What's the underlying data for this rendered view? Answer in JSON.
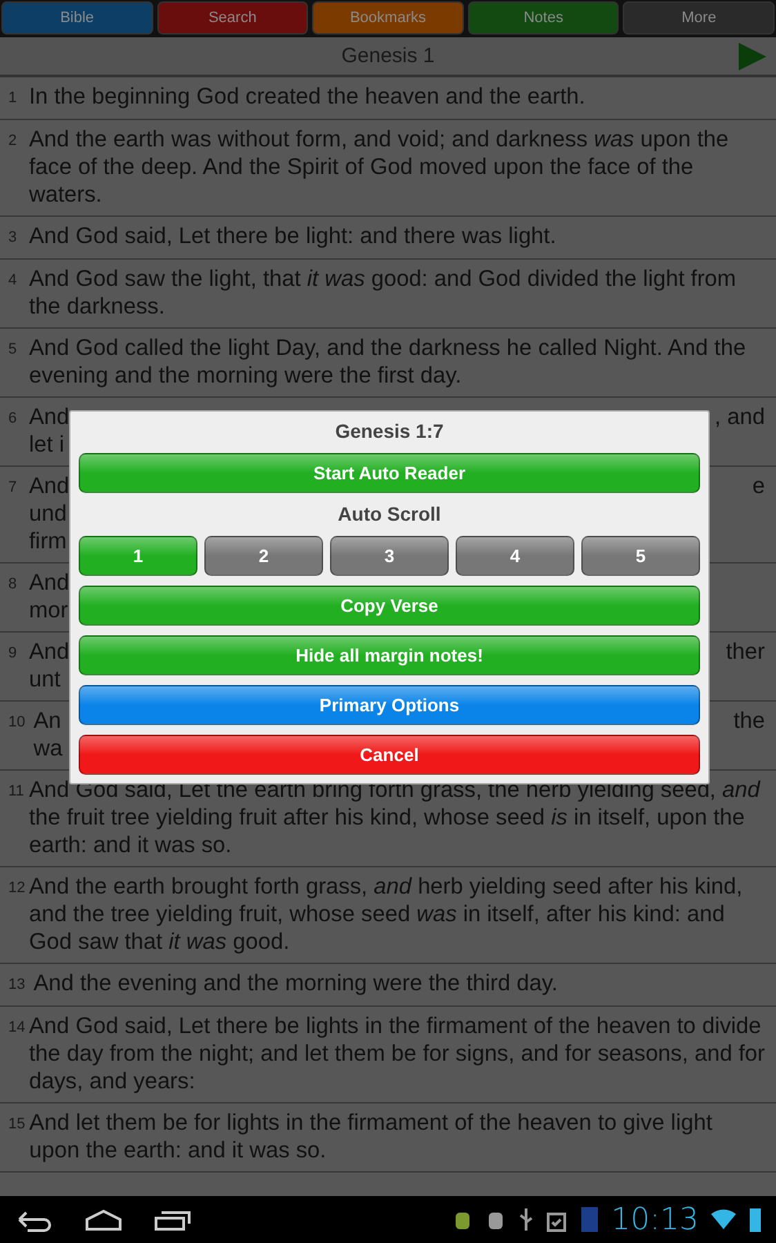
{
  "tabs": [
    {
      "label": "Bible",
      "color": "#0d3f66",
      "selected": false
    },
    {
      "label": "Search",
      "color": "#6a0d0d",
      "selected": false
    },
    {
      "label": "Bookmarks",
      "color": "#7a3a00",
      "selected": false
    },
    {
      "label": "Notes",
      "color": "#124a12",
      "selected": false
    },
    {
      "label": "More",
      "color": "#2a2a2a",
      "selected": false
    }
  ],
  "chapter_title": "Genesis 1",
  "verses": [
    {
      "number": "1",
      "text": "In the beginning God created the heaven and the earth."
    },
    {
      "number": "2",
      "text": "And the earth was without form, and void; and darkness *was* upon the face of the deep. And the Spirit of God moved upon the face of the waters."
    },
    {
      "number": "3",
      "text": "And God said, Let there be light: and there was light."
    },
    {
      "number": "4",
      "text": "And God saw the light, that *it was* good: and God divided the light from the darkness."
    },
    {
      "number": "5",
      "text": "And God called the light Day, and the darkness he called Night. And the evening and the morning were the first day."
    },
    {
      "number": "6",
      "lines": [
        {
          "start": "And",
          "end": ", and"
        },
        {
          "start": "let i"
        }
      ]
    },
    {
      "number": "7",
      "lines": [
        {
          "start": "And",
          "end": "e"
        },
        {
          "start": "und"
        },
        {
          "start": "firm"
        }
      ]
    },
    {
      "number": "8",
      "lines": [
        {
          "start": "And"
        },
        {
          "start": "mor"
        }
      ]
    },
    {
      "number": "9",
      "lines": [
        {
          "start": "And",
          "end": "ther"
        },
        {
          "start": "unt"
        }
      ]
    },
    {
      "number": "10",
      "lines": [
        {
          "start": "An",
          "end": "the"
        },
        {
          "start": "wa"
        }
      ]
    },
    {
      "number": "11",
      "text": "And God said, Let the earth bring forth grass, the herb yielding seed, *and* the fruit tree yielding fruit after his kind, whose seed *is* in itself, upon the earth: and it was so."
    },
    {
      "number": "12",
      "text": "And the earth brought forth grass, *and* herb yielding seed after his kind, and the tree yielding fruit, whose seed *was* in itself, after his kind: and God saw that *it was* good."
    },
    {
      "number": "13",
      "text": "And the evening and the morning were the third day."
    },
    {
      "number": "14",
      "text": "And God said, Let there be lights in the firmament of the heaven to divide the day from the night; and let them be for signs, and for seasons, and for days, and years:"
    },
    {
      "number": "15",
      "text": "And let them be for lights in the firmament of the heaven to give light upon the earth: and it was so."
    }
  ],
  "dialog": {
    "title": "Genesis 1:7",
    "start_button": {
      "label": "Start Auto Reader",
      "color": "#22b022"
    },
    "auto_scroll_label": "Auto Scroll",
    "speeds": [
      {
        "label": "1",
        "selected": true
      },
      {
        "label": "2",
        "selected": false
      },
      {
        "label": "3",
        "selected": false
      },
      {
        "label": "4",
        "selected": false
      },
      {
        "label": "5",
        "selected": false
      }
    ],
    "buttons": [
      {
        "label": "Copy Verse",
        "color": "#22b022"
      },
      {
        "label": "Hide all margin notes!",
        "color": "#22b022"
      },
      {
        "label": "Primary Options",
        "color": "#0a84e8"
      },
      {
        "label": "Cancel",
        "color": "#f01818"
      }
    ]
  },
  "status_bar": {
    "time": "10:13"
  }
}
